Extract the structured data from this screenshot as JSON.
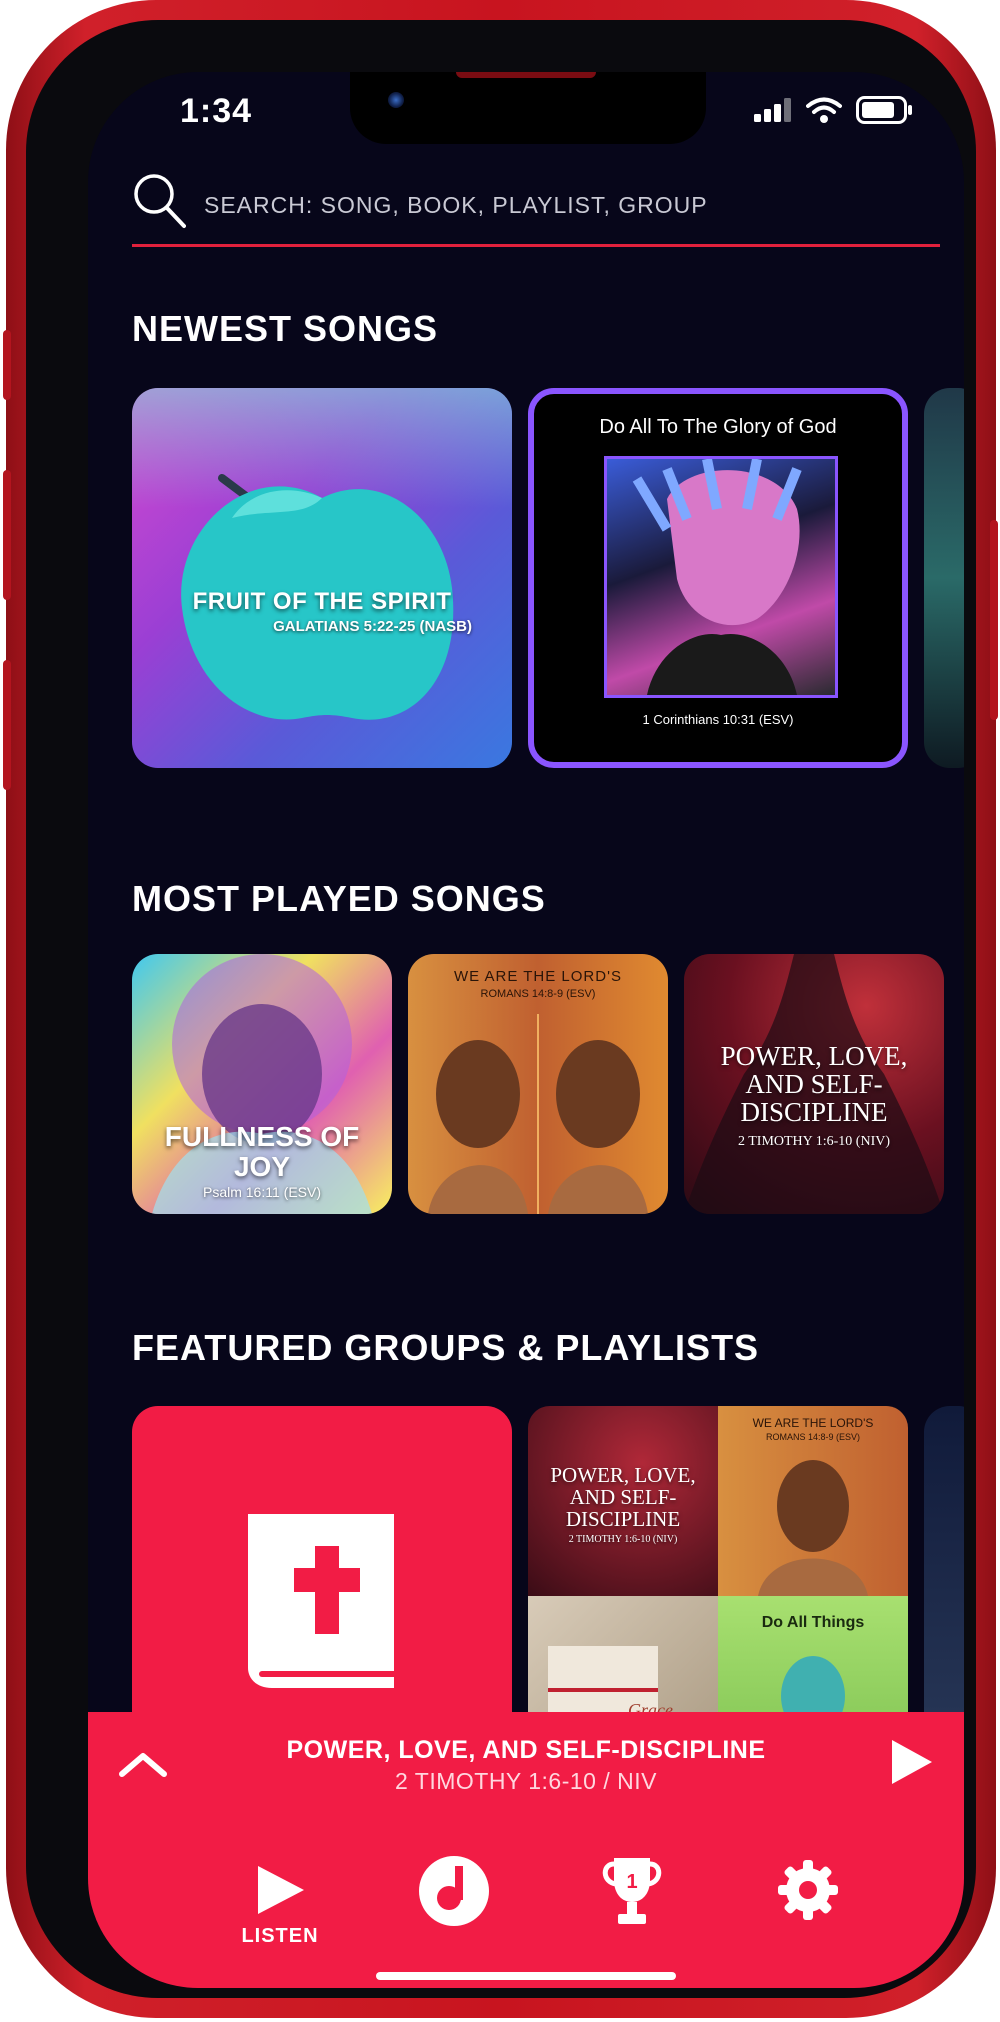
{
  "status_bar": {
    "time": "1:34"
  },
  "search": {
    "placeholder": "SEARCH: SONG, BOOK, PLAYLIST, GROUP"
  },
  "sections": {
    "newest": {
      "title": "NEWEST SONGS",
      "cards": [
        {
          "title": "FRUIT OF THE SPIRIT",
          "reference": "GALATIANS 5:22-25 (NASB)"
        },
        {
          "title": "Do All To The Glory of God",
          "reference": "1 Corinthians 10:31 (ESV)"
        }
      ]
    },
    "most_played": {
      "title": "MOST PLAYED SONGS",
      "cards": [
        {
          "title": "FULLNESS OF JOY",
          "reference": "Psalm 16:11 (ESV)"
        },
        {
          "title": "WE ARE THE LORD'S",
          "reference": "ROMANS 14:8-9 (ESV)"
        },
        {
          "title": "POWER, LOVE, AND SELF-DISCIPLINE",
          "reference": "2 TIMOTHY 1:6-10 (NIV)"
        }
      ]
    },
    "featured": {
      "title": "FEATURED GROUPS & PLAYLISTS",
      "playlist_tiles": [
        {
          "title": "POWER, LOVE, AND SELF-DISCIPLINE",
          "reference": "2 TIMOTHY 1:6-10 (NIV)"
        },
        {
          "title": "WE ARE THE LORD'S",
          "reference": "ROMANS 14:8-9 (ESV)"
        },
        {
          "title": "Grace"
        },
        {
          "title": "Do All Things"
        }
      ]
    }
  },
  "now_playing": {
    "title": "POWER, LOVE, AND SELF-DISCIPLINE",
    "subtitle": "2 TIMOTHY 1:6-10 / NIV"
  },
  "tabs": [
    {
      "label": "LISTEN",
      "icon": "play-icon",
      "active": true
    },
    {
      "label": "",
      "icon": "music-note-icon"
    },
    {
      "label": "",
      "icon": "trophy-icon"
    },
    {
      "label": "",
      "icon": "gear-icon"
    }
  ],
  "colors": {
    "accent": "#f21c45",
    "background": "#07061a",
    "frame": "#c8141f",
    "highlight_border": "#8a55ff"
  }
}
